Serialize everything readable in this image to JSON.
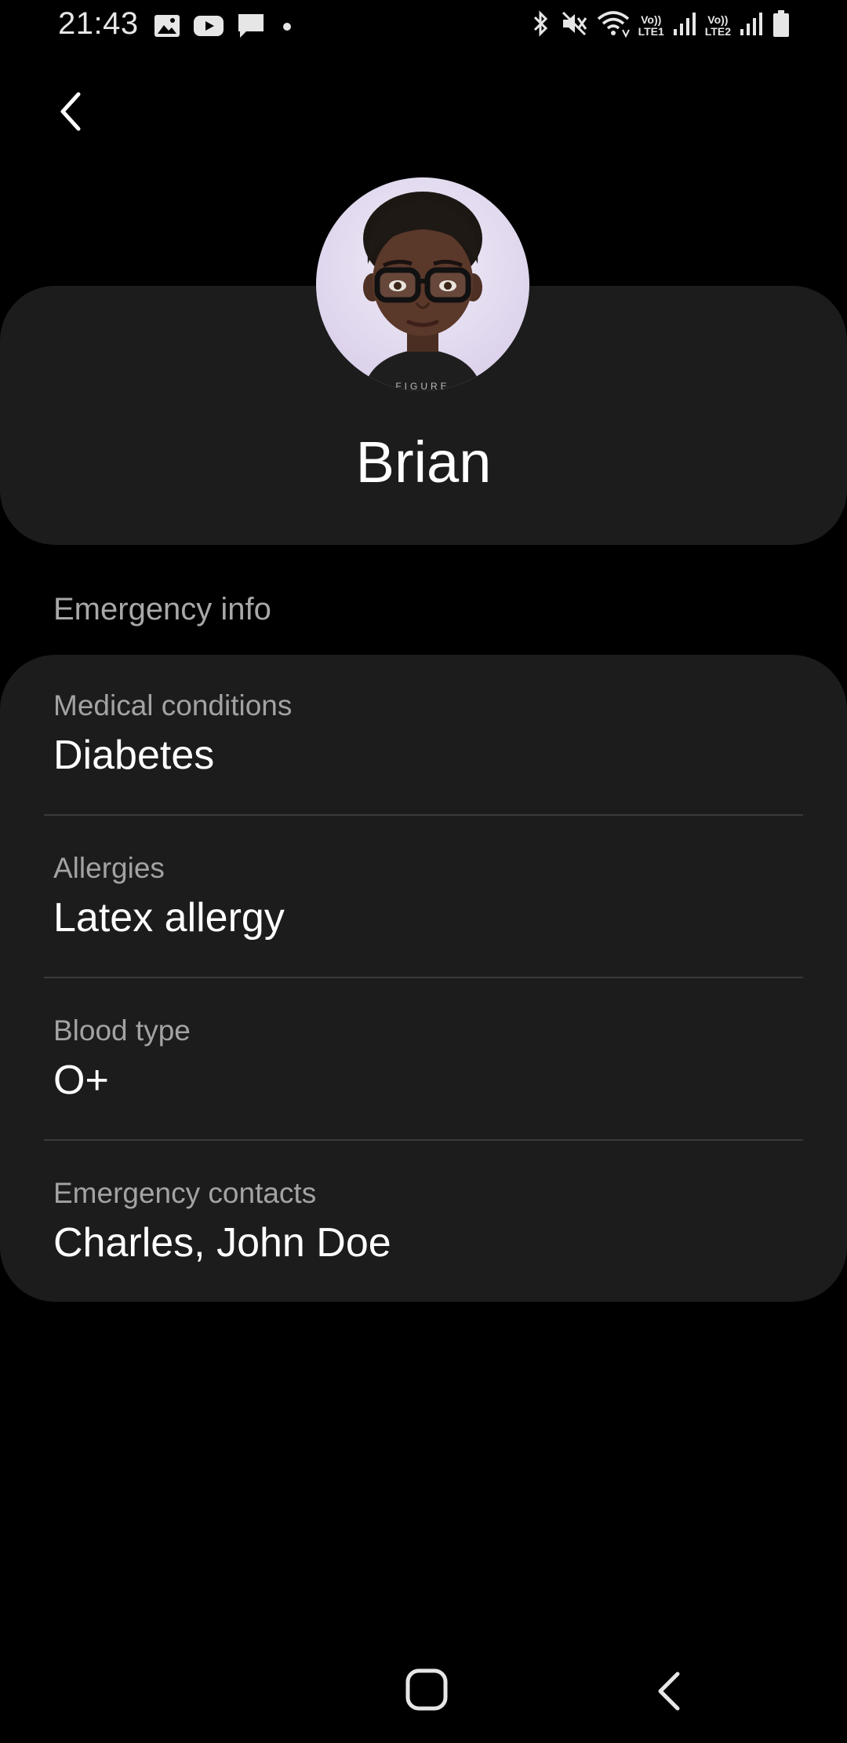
{
  "status_bar": {
    "time": "21:43",
    "left_icons": [
      "gallery-icon",
      "youtube-icon",
      "message-icon",
      "dot-icon"
    ],
    "right_icons": [
      "bluetooth-icon",
      "mute-icon",
      "wifi-icon",
      "signal-sim1-icon",
      "signal-sim2-icon",
      "battery-icon"
    ],
    "sim1_label_top": "Vo))",
    "sim1_label_bottom": "LTE1",
    "sim2_label_top": "Vo))",
    "sim2_label_bottom": "LTE2"
  },
  "header": {
    "back_icon": "chevron-left-icon"
  },
  "profile": {
    "name": "Brian",
    "avatar_icon": "avatar-emoji",
    "shirt_text": "FIGURE"
  },
  "emergency": {
    "section_title": "Emergency info",
    "items": [
      {
        "label": "Medical conditions",
        "value": "Diabetes"
      },
      {
        "label": "Allergies",
        "value": "Latex allergy"
      },
      {
        "label": "Blood type",
        "value": "O+"
      },
      {
        "label": "Emergency contacts",
        "value": "Charles, John Doe"
      }
    ]
  },
  "nav": {
    "home_icon": "home-square-icon",
    "back_icon": "back-chevron-icon"
  },
  "colors": {
    "background": "#000000",
    "card": "#1c1c1c",
    "label": "#a3a3a3",
    "divider": "#3a3a3a"
  }
}
